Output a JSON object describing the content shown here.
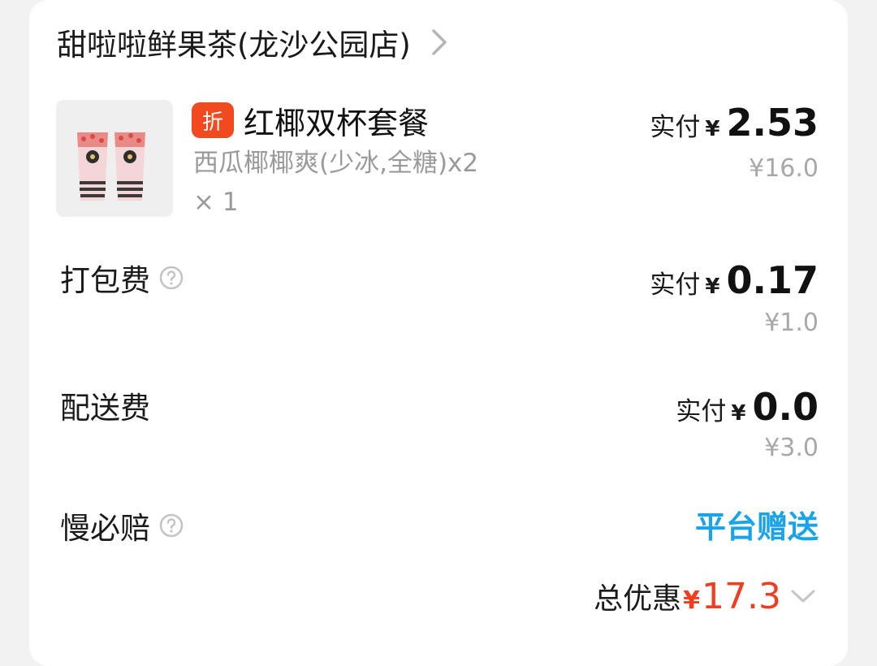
{
  "shop": {
    "name": "甜啦啦鲜果茶(龙沙公园店)",
    "chevron_icon": "chevron-right-icon"
  },
  "item": {
    "badge": "折",
    "name": "红椰双杯套餐",
    "spec": "西瓜椰椰爽(少冰,全糖)x2",
    "qty": "× 1",
    "paid_label": "实付",
    "currency": "¥",
    "paid": "2.53",
    "original": "¥16.0",
    "image_icon": "drink-cups-image"
  },
  "packing_fee": {
    "label": "打包费",
    "help_icon": "question-circle-icon",
    "paid_label": "实付",
    "currency": "¥",
    "paid": "0.17",
    "original": "¥1.0"
  },
  "delivery_fee": {
    "label": "配送费",
    "paid_label": "实付",
    "currency": "¥",
    "paid": "0.0",
    "original": "¥3.0"
  },
  "late_comp": {
    "label": "慢必赔",
    "help_icon": "question-circle-icon",
    "value": "平台赠送"
  },
  "total_discount": {
    "label": "总优惠",
    "currency": "¥",
    "value": "17.3",
    "chevron_icon": "chevron-down-icon"
  },
  "colors": {
    "badge": "#f14a1f",
    "discount_red": "#f23c1f",
    "gift_blue": "#1aa3e8",
    "muted_gray": "#a8a8a8"
  }
}
